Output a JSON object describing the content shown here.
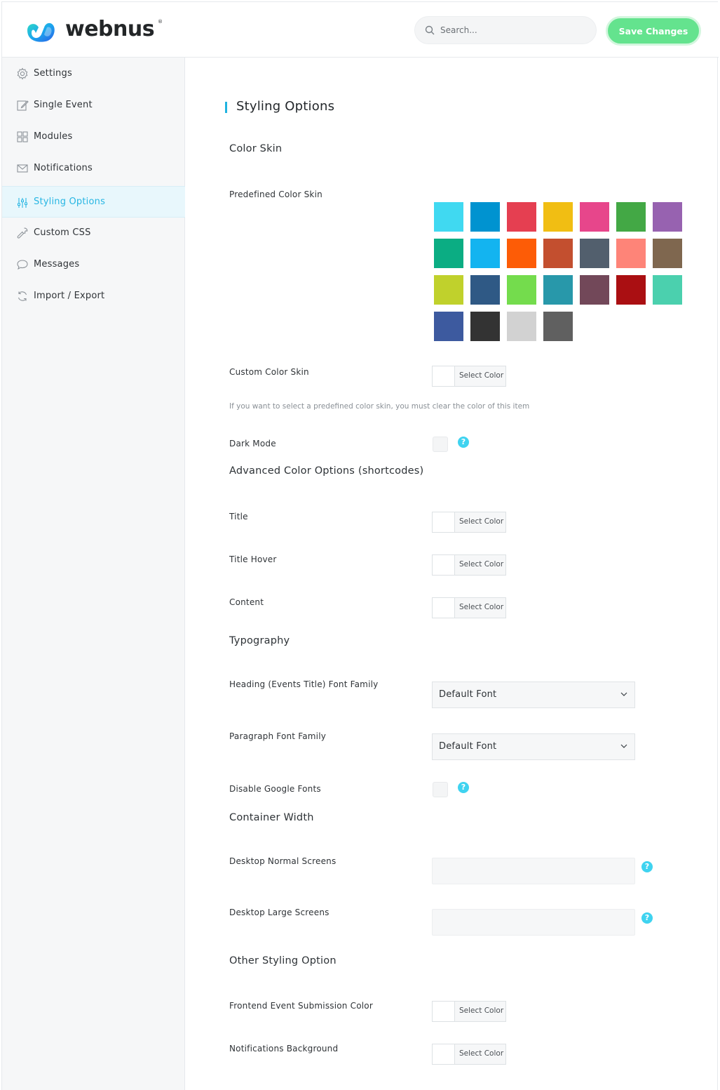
{
  "header": {
    "brand": "webnus",
    "search_placeholder": "Search...",
    "save_label": "Save Changes",
    "save_color": "#64e38e",
    "accent": "#27b6e3"
  },
  "sidebar": {
    "items": [
      {
        "label": "Settings",
        "icon": "gear-icon"
      },
      {
        "label": "Single Event",
        "icon": "edit-icon"
      },
      {
        "label": "Modules",
        "icon": "grid-icon"
      },
      {
        "label": "Notifications",
        "icon": "envelope-icon"
      },
      {
        "label": "Styling Options",
        "icon": "sliders-icon",
        "active": true
      },
      {
        "label": "Custom CSS",
        "icon": "wrench-icon"
      },
      {
        "label": "Messages",
        "icon": "chat-bubble-icon"
      },
      {
        "label": "Import / Export",
        "icon": "refresh-icon"
      }
    ]
  },
  "main": {
    "title": "Styling Options",
    "color_skin": {
      "heading": "Color Skin",
      "predefined_label": "Predefined Color Skin",
      "swatches": [
        "#40d9f1",
        "#0093d0",
        "#e53f51",
        "#f1be13",
        "#e7468b",
        "#43a845",
        "#9762b0",
        "#0bad83",
        "#13b4f0",
        "#fd5c06",
        "#c34f2f",
        "#525f6d",
        "#fe8478",
        "#7f674f",
        "#c0d12c",
        "#2f5985",
        "#74dc4d",
        "#2898aa",
        "#724859",
        "#aa0f12",
        "#4bd0ae",
        "#3d5a9f",
        "#333333",
        "#d2d2d2",
        "#606060"
      ],
      "custom_label": "Custom Color Skin",
      "select_color": "Select Color",
      "note": "If you want to select a predefined color skin, you must clear the color of this item",
      "dark_mode_label": "Dark Mode"
    },
    "advanced": {
      "heading": "Advanced Color Options (shortcodes)",
      "title_label": "Title",
      "title_hover_label": "Title Hover",
      "content_label": "Content"
    },
    "typography": {
      "heading": "Typography",
      "heading_font_label": "Heading (Events Title) Font Family",
      "heading_font_value": "Default Font",
      "paragraph_font_label": "Paragraph Font Family",
      "paragraph_font_value": "Default Font",
      "disable_google_label": "Disable Google Fonts"
    },
    "container": {
      "heading": "Container Width",
      "normal_label": "Desktop Normal Screens",
      "large_label": "Desktop Large Screens"
    },
    "other": {
      "heading": "Other Styling Option",
      "fes_label": "Frontend Event Submission Color",
      "notif_label": "Notifications Background"
    },
    "help_glyph": "?"
  }
}
